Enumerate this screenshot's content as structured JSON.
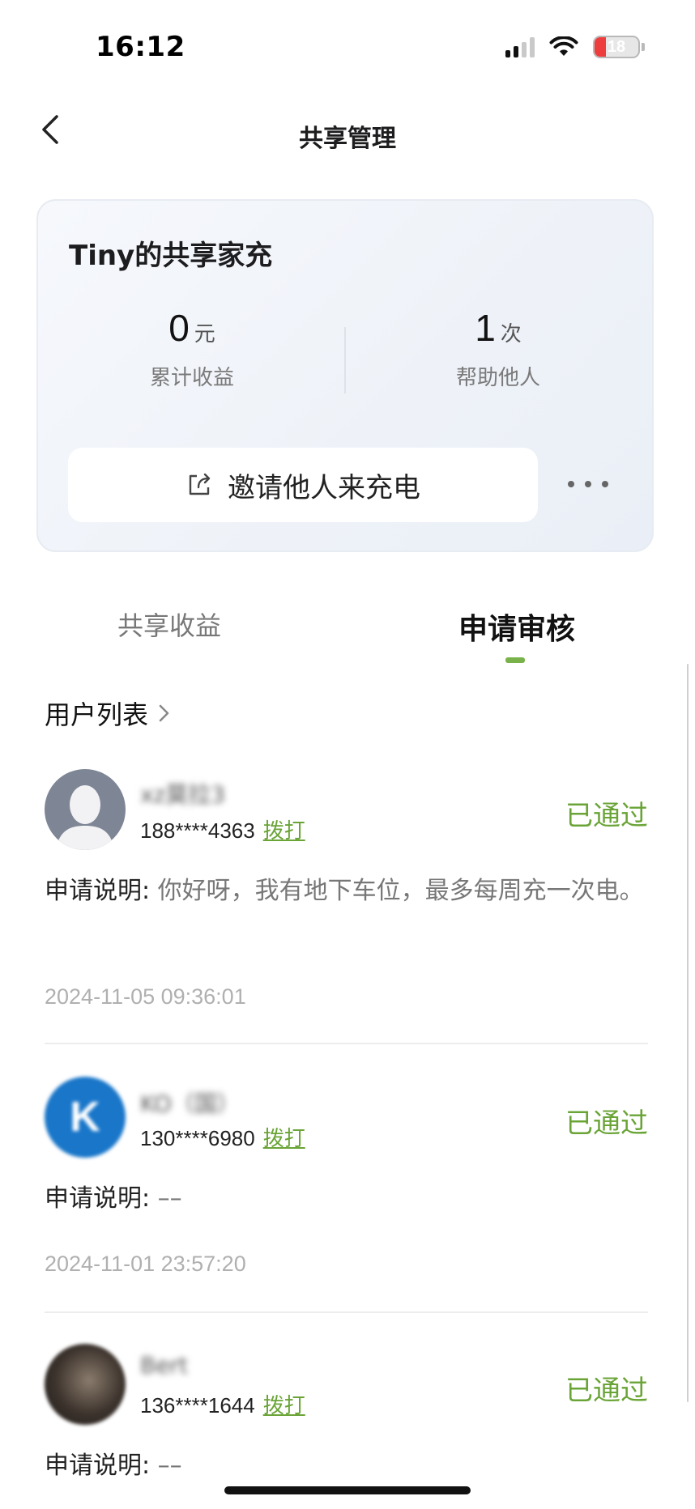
{
  "status_bar": {
    "time": "16:12",
    "battery": "18"
  },
  "nav": {
    "title": "共享管理"
  },
  "card": {
    "title": "Tiny的共享家充",
    "stats": [
      {
        "value": "0",
        "unit": "元",
        "label": "累计收益"
      },
      {
        "value": "1",
        "unit": "次",
        "label": "帮助他人"
      }
    ],
    "invite_label": "邀请他人来充电"
  },
  "tabs": [
    {
      "label": "共享收益",
      "active": false
    },
    {
      "label": "申请审核",
      "active": true
    }
  ],
  "user_list": {
    "header": "用户列表",
    "items": [
      {
        "name": "xz莫拉3",
        "phone": "188****4363",
        "call_label": "拨打",
        "status": "已通过",
        "desc_label": "申请说明:",
        "desc": " 你好呀，我有地下车位，最多每周充一次电。",
        "date": "2024-11-05 09:36:01"
      },
      {
        "name": "KO（国）",
        "phone": "130****6980",
        "call_label": "拨打",
        "status": "已通过",
        "desc_label": "申请说明:",
        "desc": " ––",
        "date": "2024-11-01 23:57:20"
      },
      {
        "name": "Bert",
        "phone": "136****1644",
        "call_label": "拨打",
        "status": "已通过",
        "desc_label": "申请说明:",
        "desc": " ––"
      }
    ]
  },
  "colors": {
    "accent_green": "#6aa437",
    "tab_indicator": "#79b24a"
  }
}
